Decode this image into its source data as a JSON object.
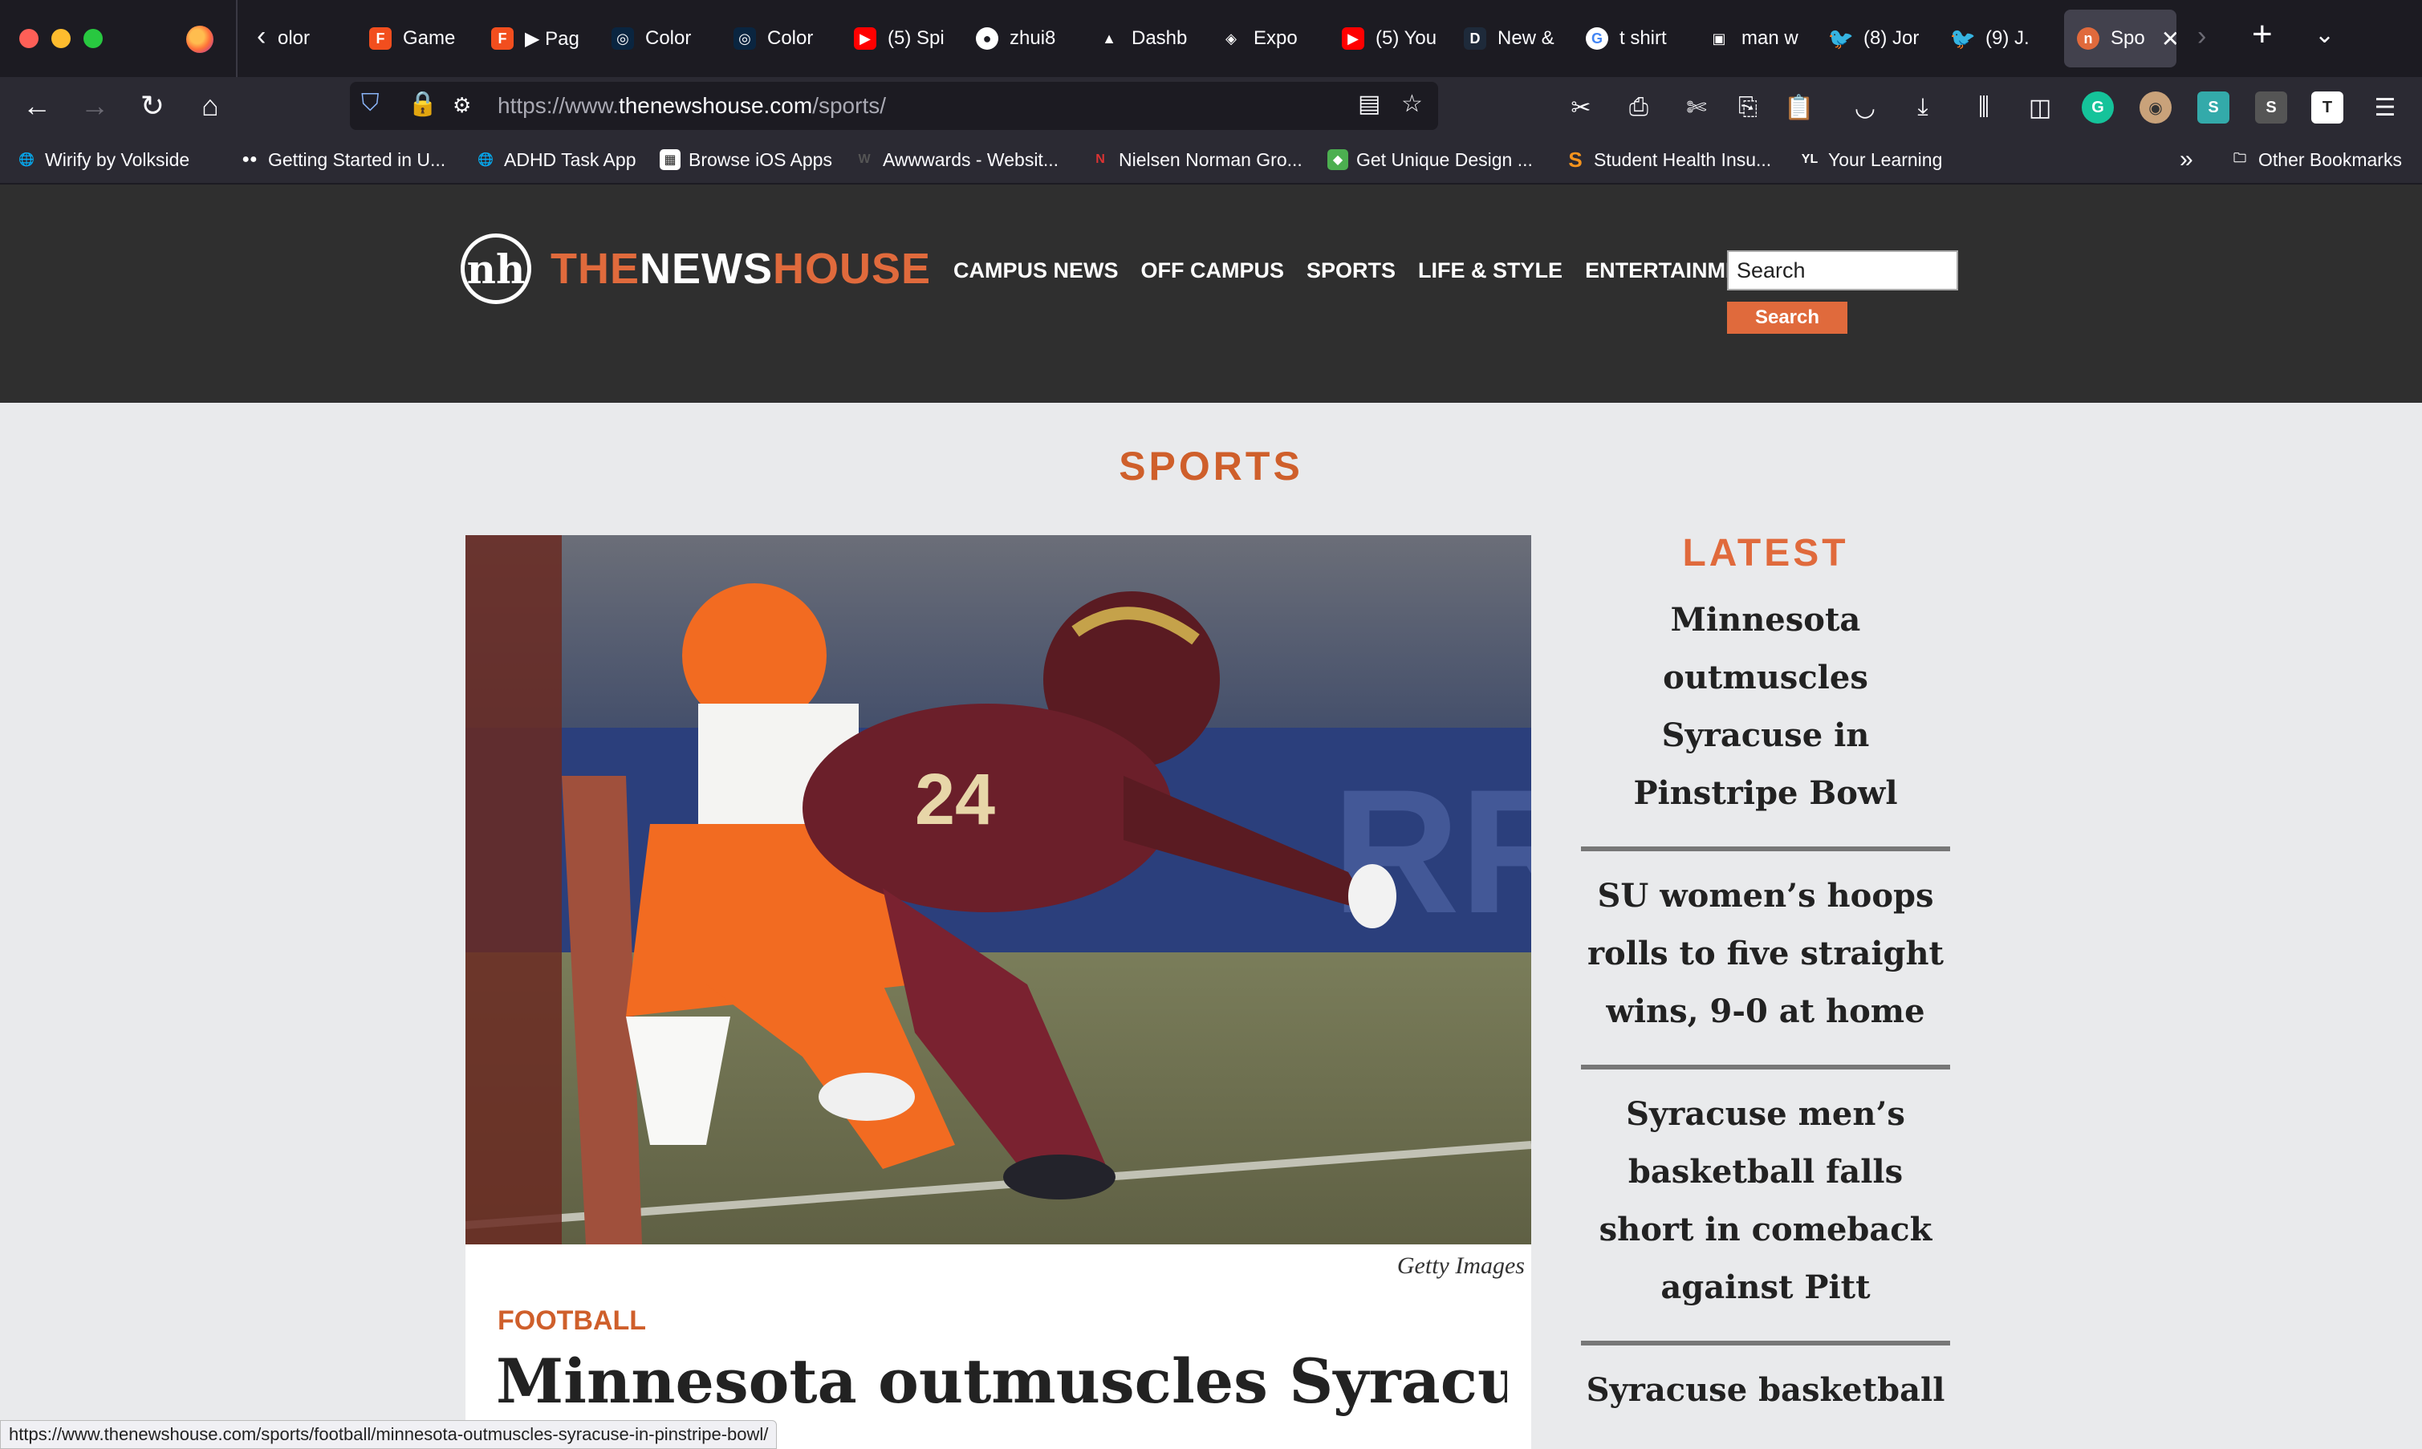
{
  "tabs": [
    {
      "title": "olor",
      "icon": "figma-icon",
      "color": "#1c1b22"
    },
    {
      "title": "Game",
      "icon": "figma-icon",
      "color": "#f24e1e"
    },
    {
      "title": "▶ Pag",
      "icon": "figma-icon",
      "color": "#f24e1e"
    },
    {
      "title": "Color",
      "icon": "coolors-icon",
      "color": "#0a2540"
    },
    {
      "title": "Color",
      "icon": "coolors-icon",
      "color": "#0a2540"
    },
    {
      "title": "(5) Spi",
      "icon": "youtube-icon",
      "color": "#ff0000"
    },
    {
      "title": "zhui8",
      "icon": "github-icon",
      "color": "#1c1b22"
    },
    {
      "title": "Dashb",
      "icon": "vercel-icon",
      "color": "#1c1b22"
    },
    {
      "title": "Expo",
      "icon": "expo-icon",
      "color": "#1c1b22"
    },
    {
      "title": "(5) You",
      "icon": "youtube-icon",
      "color": "#ff0000"
    },
    {
      "title": "New &",
      "icon": "d-icon",
      "color": "#1e2a3a"
    },
    {
      "title": "t shirt",
      "icon": "google-icon",
      "color": "#ffffff"
    },
    {
      "title": "man w",
      "icon": "unsplash-icon",
      "color": "#1c1b22"
    },
    {
      "title": "(8) Jor",
      "icon": "twitter-icon",
      "color": "#1d9bf0"
    },
    {
      "title": "(9) J.",
      "icon": "twitter-icon",
      "color": "#1d9bf0"
    },
    {
      "title": "Spo",
      "icon": "newshouse-icon",
      "color": "#e06a3c"
    }
  ],
  "address": {
    "prefix": "https://www.",
    "domain": "thenewshouse.com",
    "path": "/sports/"
  },
  "bookmarks": [
    {
      "label": "Wirify by Volkside",
      "icon": "globe-icon"
    },
    {
      "label": "Getting Started in U...",
      "icon": "medium-icon"
    },
    {
      "label": "ADHD Task App",
      "icon": "globe-icon"
    },
    {
      "label": "Browse iOS Apps",
      "icon": "mobbin-icon"
    },
    {
      "label": "Awwwards - Websit...",
      "icon": "awwwards-icon"
    },
    {
      "label": "Nielsen Norman Gro...",
      "icon": "nng-icon"
    },
    {
      "label": "Get Unique Design ...",
      "icon": "bookmark-icon"
    },
    {
      "label": "Student Health Insu...",
      "icon": "s-icon"
    },
    {
      "label": "Your Learning",
      "icon": "yl-icon"
    }
  ],
  "other_bookmarks": "Other Bookmarks",
  "site": {
    "logo": {
      "the": "THE",
      "news": "NEWS",
      "house": "HOUSE"
    },
    "nav": [
      "CAMPUS NEWS",
      "OFF CAMPUS",
      "SPORTS",
      "LIFE & STYLE",
      "ENTERTAINMENT"
    ],
    "search_value": "Search",
    "search_button": "Search"
  },
  "page_title": "SPORTS",
  "feature": {
    "caption": "Getty Images",
    "category": "FOOTBALL",
    "headline": "Minnesota outmuscles Syracuse"
  },
  "latest": {
    "title": "LATEST",
    "items": [
      "Minnesota outmuscles Syracuse in Pinstripe Bowl",
      "SU women’s hoops rolls to five straight wins, 9-0 at home",
      "Syracuse men’s basketball falls short in comeback against Pitt",
      "Syracuse basketball"
    ]
  },
  "status_url": "https://www.thenewshouse.com/sports/football/minnesota-outmuscles-syracuse-in-pinstripe-bowl/"
}
